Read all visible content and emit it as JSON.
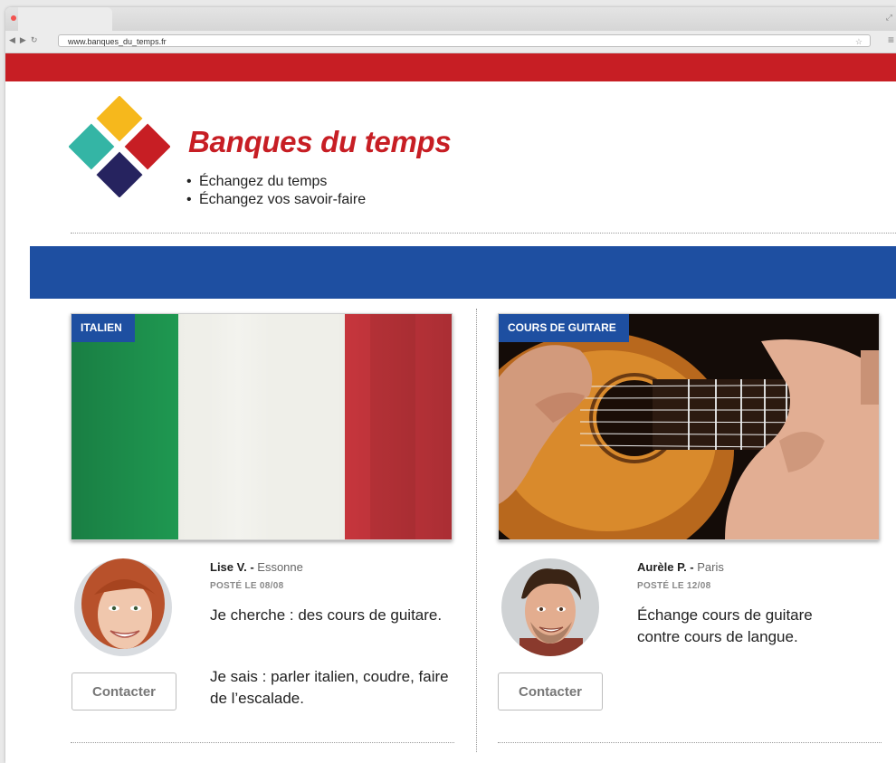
{
  "browser": {
    "url": "www.banques_du_temps.fr",
    "traffic_colors": [
      "#f2524f",
      "#f4b53b",
      "#3fbf4a"
    ]
  },
  "site": {
    "brand": "Banques du temps",
    "taglines": [
      "Échangez du temps",
      "Échangez vos savoir-faire"
    ],
    "colors": {
      "red": "#c71e24",
      "blue": "#1e4fa1"
    }
  },
  "cards": [
    {
      "tag": "ITALIEN",
      "name": "Lise V. -",
      "location": "Essonne",
      "posted": "POSTÉ LE 08/08",
      "para1": "Je cherche : des cours de guitare.",
      "para2": "Je sais : parler italien, coudre, faire de l’escalade.",
      "button": "Contacter"
    },
    {
      "tag": "COURS DE GUITARE",
      "name": "Aurèle P. -",
      "location": "Paris",
      "posted": "POSTÉ LE 12/08",
      "para1": "Échange cours de guitare contre cours de langue.",
      "button": "Contacter"
    }
  ]
}
